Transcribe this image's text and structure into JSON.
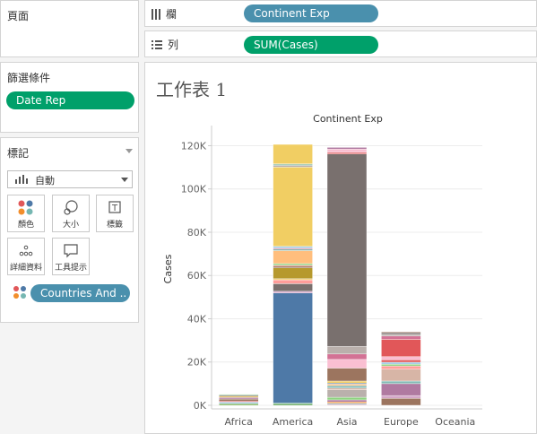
{
  "pages_panel": {
    "title": "頁面"
  },
  "columns_shelf": {
    "label": "欄",
    "pill": "Continent Exp"
  },
  "rows_shelf": {
    "label": "列",
    "pill": "SUM(Cases)"
  },
  "filters_panel": {
    "title": "篩選條件",
    "pill": "Date Rep"
  },
  "marks_panel": {
    "title": "標記",
    "mark_type": "自動",
    "buttons": [
      {
        "label": "顏色",
        "icon": "color-dots-icon"
      },
      {
        "label": "大小",
        "icon": "size-icon"
      },
      {
        "label": "標籤",
        "icon": "text-label-icon"
      },
      {
        "label": "詳細資料",
        "icon": "detail-dots-icon"
      },
      {
        "label": "工具提示",
        "icon": "tooltip-icon"
      }
    ],
    "color_pill": "Countries And .."
  },
  "worksheet": {
    "title": "工作表 1"
  },
  "chart_data": {
    "type": "bar",
    "stacked": true,
    "title": "Continent Exp",
    "xlabel": "",
    "ylabel": "Cases",
    "ylim": [
      0,
      126000
    ],
    "y_ticks": [
      0,
      20000,
      40000,
      60000,
      80000,
      100000,
      120000
    ],
    "y_tick_labels": [
      "0K",
      "20K",
      "40K",
      "60K",
      "80K",
      "100K",
      "120K"
    ],
    "categories": [
      "Africa",
      "America",
      "Asia",
      "Europe",
      "Oceania"
    ],
    "grid": true,
    "stacks": {
      "Africa": [
        {
          "v": 800,
          "c": "#7fb35a"
        },
        {
          "v": 700,
          "c": "#a0cbe8"
        },
        {
          "v": 500,
          "c": "#e15759"
        },
        {
          "v": 900,
          "c": "#9c755f"
        },
        {
          "v": 700,
          "c": "#b07aa1"
        },
        {
          "v": 600,
          "c": "#f1ce63"
        },
        {
          "v": 500,
          "c": "#79706e"
        },
        {
          "v": 300,
          "c": "#59a14f"
        }
      ],
      "America": [
        {
          "v": 700,
          "c": "#59a14f"
        },
        {
          "v": 400,
          "c": "#499894"
        },
        {
          "v": 50800,
          "c": "#4e79a7"
        },
        {
          "v": 800,
          "c": "#d4a6c8"
        },
        {
          "v": 3500,
          "c": "#79706e"
        },
        {
          "v": 1800,
          "c": "#ff9d9a"
        },
        {
          "v": 500,
          "c": "#f1ce63"
        },
        {
          "v": 5000,
          "c": "#b6992d"
        },
        {
          "v": 800,
          "c": "#9c755f"
        },
        {
          "v": 400,
          "c": "#e15759"
        },
        {
          "v": 800,
          "c": "#8cd17d"
        },
        {
          "v": 6000,
          "c": "#ffbe7d"
        },
        {
          "v": 700,
          "c": "#86bcb6"
        },
        {
          "v": 500,
          "c": "#d37295"
        },
        {
          "v": 800,
          "c": "#a0cbe8"
        },
        {
          "v": 36600,
          "c": "#f1ce63"
        },
        {
          "v": 800,
          "c": "#bab0ac"
        },
        {
          "v": 400,
          "c": "#499894"
        },
        {
          "v": 300,
          "c": "#59a14f"
        },
        {
          "v": 9000,
          "c": "#f1ce63"
        }
      ],
      "Asia": [
        {
          "v": 300,
          "c": "#e15759"
        },
        {
          "v": 600,
          "c": "#a0cbe8"
        },
        {
          "v": 700,
          "c": "#f28e2b"
        },
        {
          "v": 900,
          "c": "#b07aa1"
        },
        {
          "v": 1200,
          "c": "#8cd17d"
        },
        {
          "v": 3500,
          "c": "#bab0ac"
        },
        {
          "v": 800,
          "c": "#d7b5a6"
        },
        {
          "v": 1100,
          "c": "#86bcb6"
        },
        {
          "v": 700,
          "c": "#ffbe7d"
        },
        {
          "v": 500,
          "c": "#4e79a7"
        },
        {
          "v": 900,
          "c": "#f1ce63"
        },
        {
          "v": 6000,
          "c": "#9c755f"
        },
        {
          "v": 4000,
          "c": "#fabfd2"
        },
        {
          "v": 2500,
          "c": "#d37295"
        },
        {
          "v": 3500,
          "c": "#bab0ac"
        },
        {
          "v": 89000,
          "c": "#79706e"
        },
        {
          "v": 700,
          "c": "#e15759"
        },
        {
          "v": 1500,
          "c": "#fabfd2"
        },
        {
          "v": 800,
          "c": "#b07aa1"
        }
      ],
      "Europe": [
        {
          "v": 3200,
          "c": "#9c755f"
        },
        {
          "v": 1300,
          "c": "#d4a6c8"
        },
        {
          "v": 5500,
          "c": "#b07aa1"
        },
        {
          "v": 1200,
          "c": "#86bcb6"
        },
        {
          "v": 5500,
          "c": "#d7b5a6"
        },
        {
          "v": 1500,
          "c": "#ff9d9a"
        },
        {
          "v": 800,
          "c": "#8cd17d"
        },
        {
          "v": 900,
          "c": "#a0cbe8"
        },
        {
          "v": 1100,
          "c": "#e15759"
        },
        {
          "v": 1500,
          "c": "#fabfd2"
        },
        {
          "v": 8000,
          "c": "#e15759"
        },
        {
          "v": 1500,
          "c": "#d37295"
        },
        {
          "v": 800,
          "c": "#bab0ac"
        },
        {
          "v": 800,
          "c": "#79706e"
        },
        {
          "v": 400,
          "c": "#9c755f"
        }
      ],
      "Oceania": []
    }
  }
}
